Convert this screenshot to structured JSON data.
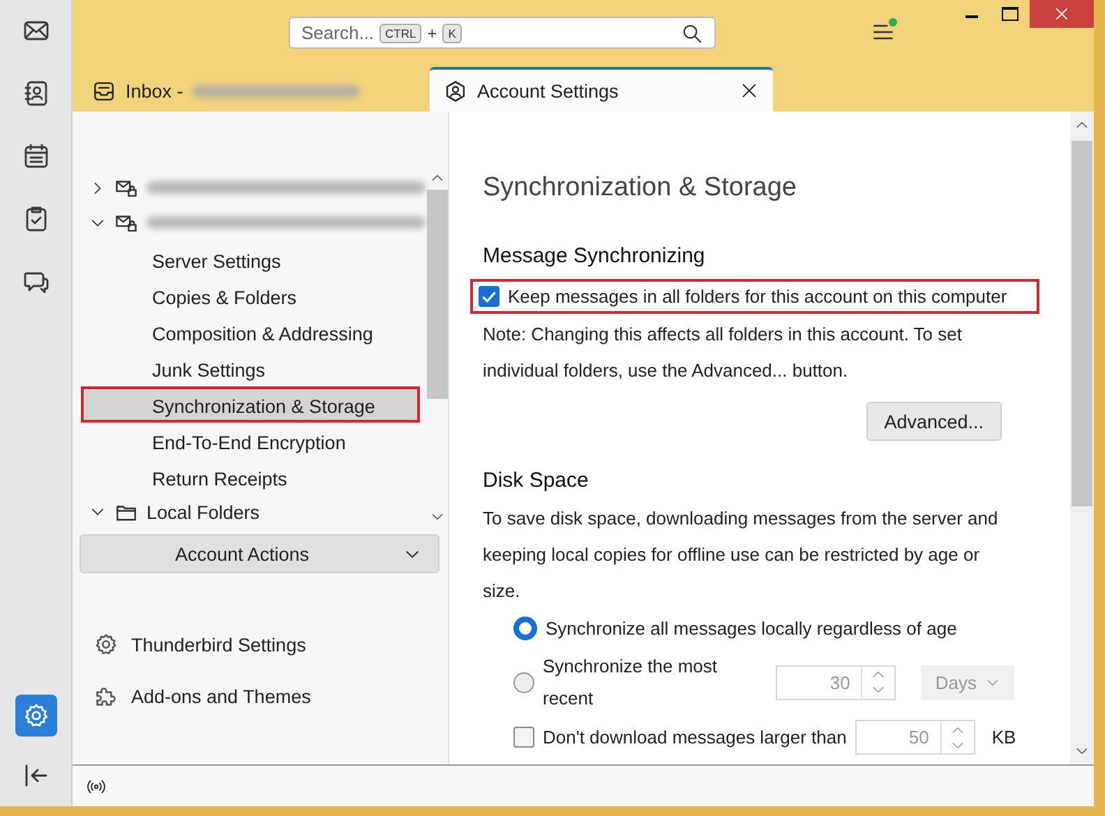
{
  "search": {
    "placeholder": "Search...",
    "shortcut_keys": [
      "CTRL",
      "K"
    ],
    "key_separator": "+"
  },
  "spaces": [
    {
      "kind": "mail",
      "selected": false
    },
    {
      "kind": "address-book",
      "selected": false
    },
    {
      "kind": "calendar",
      "selected": false
    },
    {
      "kind": "tasks",
      "selected": false
    },
    {
      "kind": "chat",
      "selected": false
    },
    {
      "kind": "settings",
      "selected": true
    }
  ],
  "tabs": [
    {
      "kind": "inbox",
      "label": "Inbox -",
      "redacted": true,
      "selected": false,
      "closable": false
    },
    {
      "kind": "account",
      "label": "Account Settings",
      "redacted": false,
      "selected": true,
      "closable": true
    }
  ],
  "account_tree": [
    {
      "kind": "account",
      "redacted": true,
      "expanded": false
    },
    {
      "kind": "account",
      "redacted": true,
      "expanded": true,
      "children": [
        {
          "label": "Server Settings",
          "selected": false,
          "highlighted": false
        },
        {
          "label": "Copies & Folders",
          "selected": false,
          "highlighted": false
        },
        {
          "label": "Composition & Addressing",
          "selected": false,
          "highlighted": false
        },
        {
          "label": "Junk Settings",
          "selected": false,
          "highlighted": false
        },
        {
          "label": "Synchronization & Storage",
          "selected": true,
          "highlighted": true
        },
        {
          "label": "End-To-End Encryption",
          "selected": false,
          "highlighted": false
        },
        {
          "label": "Return Receipts",
          "selected": false,
          "highlighted": false
        }
      ]
    },
    {
      "kind": "folder",
      "label": "Local Folders",
      "redacted": false,
      "expanded": true
    }
  ],
  "account_actions": {
    "label": "Account Actions"
  },
  "footer_links": [
    {
      "kind": "settings",
      "label": "Thunderbird Settings"
    },
    {
      "kind": "addons",
      "label": "Add-ons and Themes"
    }
  ],
  "page": {
    "title": "Synchronization & Storage",
    "message_sync": {
      "heading": "Message Synchronizing",
      "checkbox": {
        "label": "Keep messages in all folders for this account on this computer",
        "checked": true,
        "highlighted": true
      },
      "note": "Note: Changing this affects all folders in this account. To set individual folders, use the Advanced... button.",
      "button": "Advanced..."
    },
    "disk_space": {
      "heading": "Disk Space",
      "description": "To save disk space, downloading messages from the server and keeping local copies for offline use can be restricted by age or size.",
      "options": [
        {
          "kind": "radio",
          "label": "Synchronize all messages locally regardless of age",
          "selected": true
        },
        {
          "kind": "radio",
          "label": "Synchronize the most recent",
          "selected": false,
          "number": "30",
          "unit_dropdown": "Days"
        },
        {
          "kind": "checkbox",
          "label": "Don't download messages larger than",
          "checked": false,
          "number": "50",
          "unit": "KB"
        }
      ]
    }
  }
}
